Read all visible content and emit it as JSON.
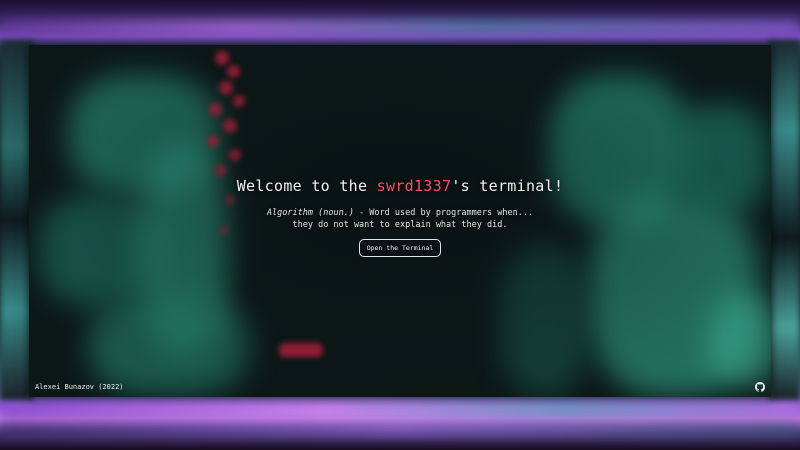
{
  "hero": {
    "headline_prefix": "Welcome to the ",
    "headline_handle": "swrd1337",
    "headline_suffix": "'s terminal!",
    "definition_term": "Algorithm (noun.)",
    "definition_line1_rest": " - Word used by programmers when...",
    "definition_line2": "they do not want to explain what they did.",
    "open_button_label": "Open the Terminal"
  },
  "footer": {
    "author": "Alexei Bunazov (2022)",
    "github_icon": "github-icon"
  },
  "colors": {
    "accent_handle": "#ff4d6a",
    "text": "#f2f2f2",
    "background_teal": "#2fb595",
    "background_red": "#e0264a"
  }
}
